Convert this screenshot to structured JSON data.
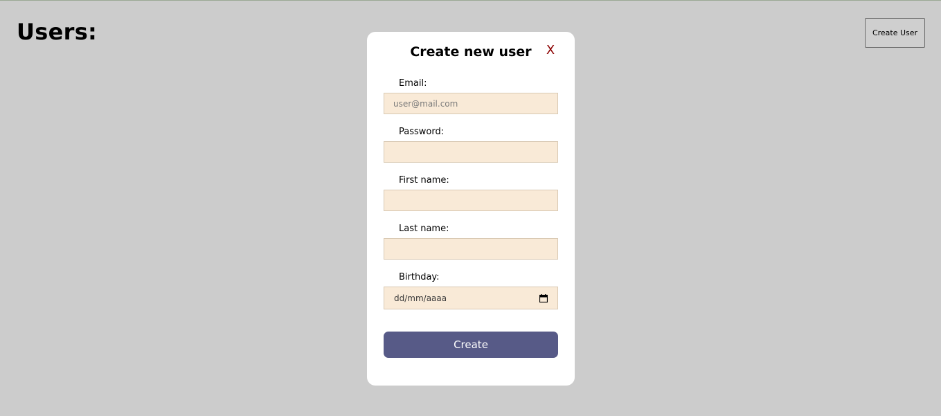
{
  "page": {
    "title": "Users:",
    "create_user_button": "Create User"
  },
  "modal": {
    "title": "Create new user",
    "close_label": "X",
    "fields": [
      {
        "label": "Email:",
        "value": "",
        "placeholder": "user@mail.com"
      },
      {
        "label": "Password:",
        "value": "",
        "placeholder": ""
      },
      {
        "label": "First name:",
        "value": "",
        "placeholder": ""
      },
      {
        "label": "Last name:",
        "value": "",
        "placeholder": ""
      },
      {
        "label": "Birthday:",
        "value": "",
        "placeholder": "dd/mm/aaaa",
        "icon": "calendar-icon"
      }
    ],
    "submit_label": "Create"
  },
  "colors": {
    "background": "#cccccc",
    "modal_background": "#ffffff",
    "input_background": "#f9ead7",
    "submit_button": "#575a87",
    "close_icon": "#8b0000"
  }
}
